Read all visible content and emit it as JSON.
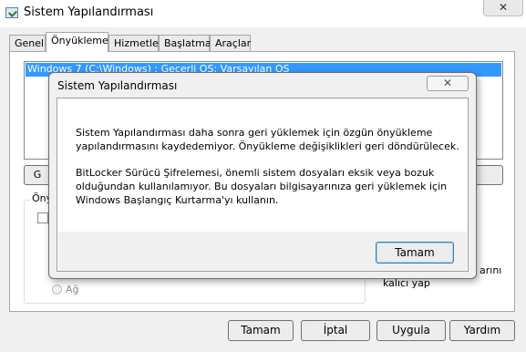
{
  "window": {
    "title": "Sistem Yapılandırması",
    "close_glyph": "✕"
  },
  "tabs": [
    {
      "label": "Genel"
    },
    {
      "label": "Önyükleme"
    },
    {
      "label": "Hizmetler"
    },
    {
      "label": "Başlatma"
    },
    {
      "label": "Araçlar"
    }
  ],
  "boot_list": {
    "selected_entry": "Windows 7 (C:\\Windows) : Geçerli OS; Varsayılan OS"
  },
  "partial_labels": {
    "group_label": "Öny",
    "left_button": "G",
    "radio_option": "Ağ",
    "right_text_1": "arını",
    "right_text_2": "kalıcı yap"
  },
  "footer": {
    "ok": "Tamam",
    "cancel": "İptal",
    "apply": "Uygula",
    "help": "Yardım"
  },
  "dialog": {
    "title": "Sistem Yapılandırması",
    "close_glyph": "✕",
    "line1": "Sistem Yapılandırması daha sonra geri yüklemek için özgün önyükleme",
    "line2": "yapılandırmasını kaydedemiyor. Önyükleme değişiklikleri geri döndürülecek.",
    "line3": "BitLocker Sürücü Şifrelemesi, önemli sistem dosyaları eksik veya bozuk",
    "line4": "olduğundan kullanılamıyor. Bu dosyaları bilgisayarınıza geri yüklemek için",
    "line5": "Windows Başlangıç Kurtarma'yı kullanın.",
    "ok": "Tamam"
  }
}
